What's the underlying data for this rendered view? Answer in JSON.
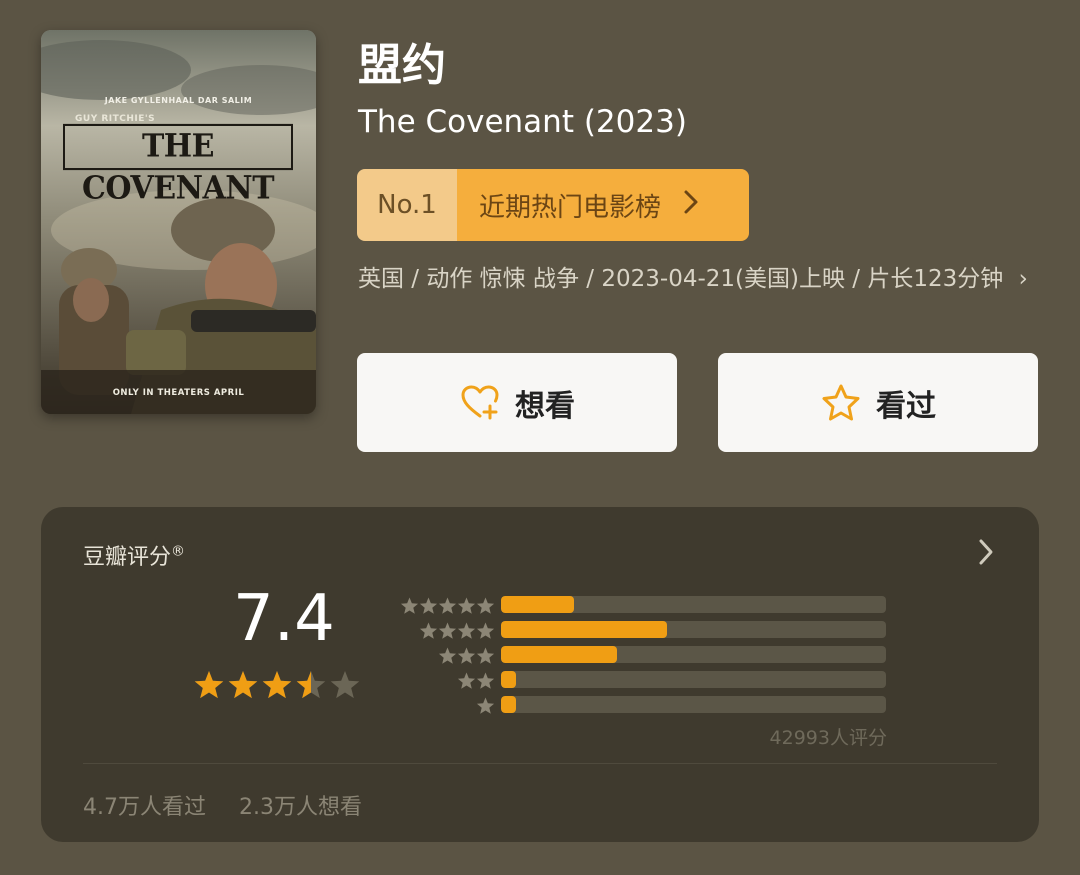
{
  "poster": {
    "cast": "JAKE GYLLENHAAL     DAR SALIM",
    "director": "GUY RITCHIE'S",
    "title": "THE COVENANT",
    "footer": "ONLY IN THEATERS APRIL"
  },
  "movie": {
    "title_cn": "盟约",
    "title_en": "The Covenant (2023)",
    "rank_no": "No.1",
    "rank_label": "近期热门电影榜",
    "meta": "英国 / 动作 惊悚 战争 / 2023-04-21(美国)上映 / 片长123分钟",
    "meta_chevron": "›"
  },
  "actions": {
    "want_label": "想看",
    "seen_label": "看过"
  },
  "rating": {
    "label": "豆瓣评分",
    "reg_mark": "®",
    "score": "7.4",
    "score_stars": 3.5,
    "votes": "42993人评分",
    "distribution": [
      {
        "stars": 5,
        "fraction": 0.19
      },
      {
        "stars": 4,
        "fraction": 0.43
      },
      {
        "stars": 3,
        "fraction": 0.3
      },
      {
        "stars": 2,
        "fraction": 0.04
      },
      {
        "stars": 1,
        "fraction": 0.04
      }
    ],
    "seen_count": "4.7万人看过",
    "want_count": "2.3万人想看"
  },
  "colors": {
    "accent": "#f09e14",
    "badge_light": "#f3ca8a",
    "badge_dark": "#f5ae3d",
    "background": "#5b5444",
    "card": "#3f3a2e"
  }
}
